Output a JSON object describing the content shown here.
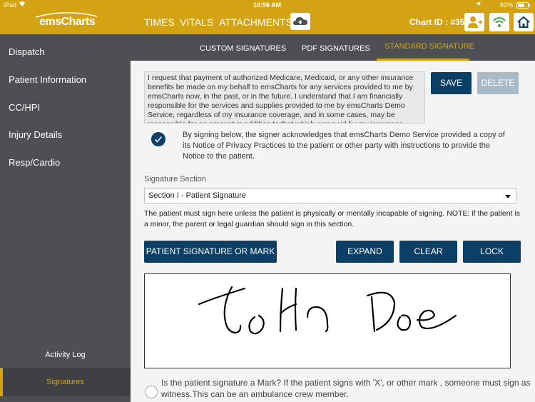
{
  "status_bar": {
    "device": "iPad",
    "time": "10:56 AM",
    "battery": "62%"
  },
  "header": {
    "logo": "emsCharts",
    "nav": [
      "TIMES",
      "VITALS",
      "ATTACHMENTS"
    ],
    "chart_id": "Chart ID : #35",
    "icons": [
      "cloud-upload-icon",
      "add-user-icon",
      "wifi-icon",
      "home-icon"
    ]
  },
  "sidebar": {
    "items": [
      "Dispatch",
      "Patient Information",
      "CC/HPI",
      "Injury Details",
      "Resp/Cardio"
    ],
    "activity_log": "Activity Log",
    "signatures": "Signatures"
  },
  "tabs": [
    "CUSTOM SIGNATURES",
    "PDF SIGNATURES",
    "STANDARD SIGNATURE"
  ],
  "active_tab": "STANDARD SIGNATURE",
  "consent_text": "I request that payment of authorized Medicare, Medicaid, or any other insurance benefits be made on my behalf to emsCharts for any services provided to me by emsCharts now, in the past, or in the future. I understand that I am financially responsible for the services and supplies provided to me by emsCharts Demo Service, regardless of my insurance coverage, and in some cases, may be responsible for an amount in addition to that which was paid by my insurance.",
  "buttons": {
    "save": "SAVE",
    "delete": "DELETE",
    "patient_signature": "PATIENT SIGNATURE OR MARK",
    "expand": "EXPAND",
    "clear": "CLEAR",
    "lock": "LOCK"
  },
  "acknowledgement": "By signing below, the signer acknowledges that emsCharts Demo Service provided a copy of its Notice of Privacy Practices to the patient or other party with instructions to provide the Notice to the patient.",
  "signature_section": {
    "label": "Signature Section",
    "value": "Section I - Patient Signature"
  },
  "section_note": "The patient must sign here unless the patient is physically or mentally incapable of signing.  NOTE: if the patient is a minor, the parent or legal guardian should sign in this section.",
  "mark_question": [
    "Is the patient signature a Mark? If the patient signs with 'X', or other mark , someone must sign as",
    "witness.This can be an ambulance crew member."
  ],
  "colors": {
    "brand": "#d4a313",
    "sidebar": "#4d4f52",
    "button": "#0b3f66"
  }
}
